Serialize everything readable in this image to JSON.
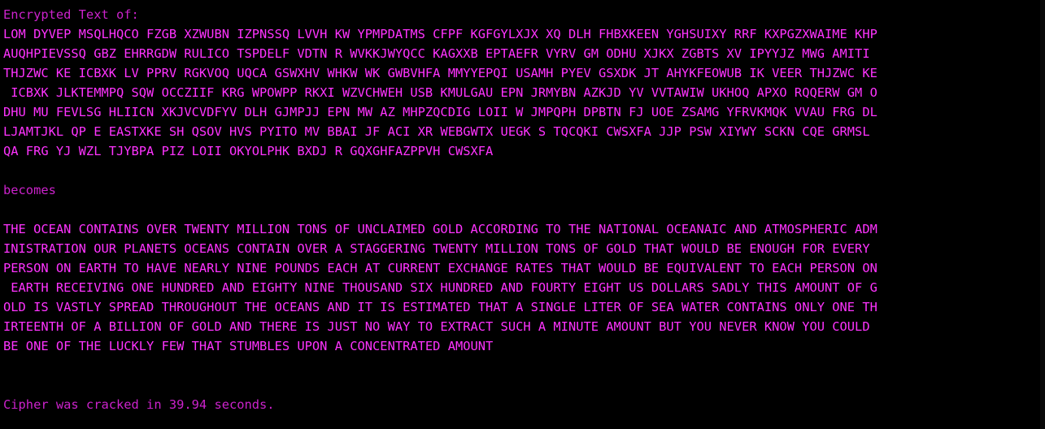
{
  "header_label": "Encrypted Text of:",
  "cipher_lines": [
    "LOM DYVEP MSQLHQCO FZGB XZWUBN IZPNSSQ LVVH KW YPMPDATMS CFPF KGFGYLXJX XQ DLH FHBXKEEN YGHSUIXY RRF KXPGZXWAIME KHP",
    "AUQHPIEVSSQ GBZ EHRRGDW RULICO TSPDELF VDTN R WVKKJWYQCC KAGXXB EPTAEFR VYRV GM ODHU XJKX ZGBTS XV IPYYJZ MWG AMITI",
    "THJZWC KE ICBXK LV PPRV RGKVOQ UQCA GSWXHV WHKW WK GWBVHFA MMYYEPQI USAMH PYEV GSXDK JT AHYKFEOWUB IK VEER THJZWC KE",
    " ICBXK JLKTEMMPQ SQW OCCZIIF KRG WPOWPP RKXI WZVCHWEH USB KMULGAU EPN JRMYBN AZKJD YV VVTAWIW UKHOQ APXO RQQERW GM O",
    "DHU MU FEVLSG HLIICN XKJVCVDFYV DLH GJMPJJ EPN MW AZ MHPZQCDIG LOII W JMPQPH DPBTN FJ UOE ZSAMG YFRVKMQK VVAU FRG DL",
    "LJAMTJKL QP E EASTXKE SH QSOV HVS PYITO MV BBAI JF ACI XR WEBGWTX UEGK S TQCQKI CWSXFA JJP PSW XIYWY SCKN CQE GRMSL",
    "QA FRG YJ WZL TJYBPA PIZ LOII OKYOLPHK BXDJ R GQXGHFAZPPVH CWSXFA"
  ],
  "middle_label": "becomes",
  "plain_lines": [
    "THE OCEAN CONTAINS OVER TWENTY MILLION TONS OF UNCLAIMED GOLD ACCORDING TO THE NATIONAL OCEANAIC AND ATMOSPHERIC ADM",
    "INISTRATION OUR PLANETS OCEANS CONTAIN OVER A STAGGERING TWENTY MILLION TONS OF GOLD THAT WOULD BE ENOUGH FOR EVERY",
    "PERSON ON EARTH TO HAVE NEARLY NINE POUNDS EACH AT CURRENT EXCHANGE RATES THAT WOULD BE EQUIVALENT TO EACH PERSON ON",
    " EARTH RECEIVING ONE HUNDRED AND EIGHTY NINE THOUSAND SIX HUNDRED AND FOURTY EIGHT US DOLLARS SADLY THIS AMOUNT OF G",
    "OLD IS VASTLY SPREAD THROUGHOUT THE OCEANS AND IT IS ESTIMATED THAT A SINGLE LITER OF SEA WATER CONTAINS ONLY ONE TH",
    "IRTEENTH OF A BILLION OF GOLD AND THERE IS JUST NO WAY TO EXTRACT SUCH A MINUTE AMOUNT BUT YOU NEVER KNOW YOU COULD",
    "BE ONE OF THE LUCKLY FEW THAT STUMBLES UPON A CONCENTRATED AMOUNT"
  ],
  "status_line": "Cipher was cracked in 39.94 seconds."
}
